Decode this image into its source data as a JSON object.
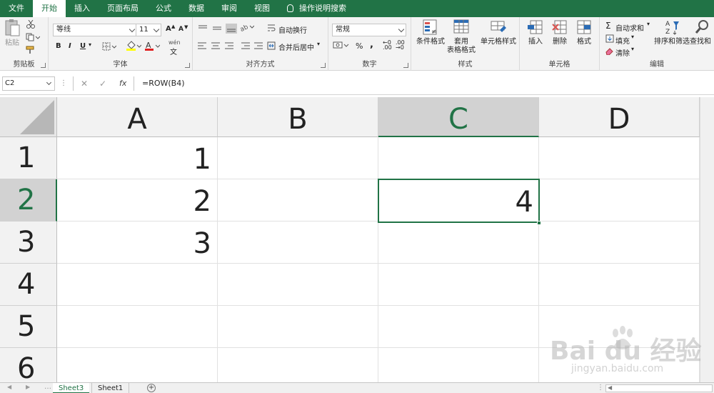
{
  "tabs": [
    {
      "label": "文件",
      "active": false
    },
    {
      "label": "开始",
      "active": true
    },
    {
      "label": "插入",
      "active": false
    },
    {
      "label": "页面布局",
      "active": false
    },
    {
      "label": "公式",
      "active": false
    },
    {
      "label": "数据",
      "active": false
    },
    {
      "label": "审阅",
      "active": false
    },
    {
      "label": "视图",
      "active": false
    }
  ],
  "tell_me": "操作说明搜索",
  "ribbon": {
    "clipboard": {
      "paste": "粘贴",
      "label": "剪贴板"
    },
    "font": {
      "name": "等线",
      "size": "11",
      "bold": "B",
      "italic": "I",
      "underline": "U",
      "grow": "A",
      "shrink": "A",
      "wen": "wén",
      "label": "字体"
    },
    "alignment": {
      "wrap": "自动换行",
      "merge": "合并后居中",
      "label": "对齐方式"
    },
    "number": {
      "format": "常规",
      "percent": "%",
      "comma": ",",
      "label": "数字"
    },
    "styles": {
      "conditional": "条件格式",
      "table_a": "套用",
      "table_b": "表格格式",
      "cell_styles": "单元格样式",
      "label": "样式"
    },
    "cells": {
      "insert": "插入",
      "delete": "删除",
      "format": "格式",
      "label": "单元格"
    },
    "editing": {
      "autosum": "自动求和",
      "fill": "填充",
      "clear": "清除",
      "sort": "排序和筛选",
      "find": "查找和",
      "label": "编辑"
    }
  },
  "formula_bar": {
    "name_box": "C2",
    "fx": "fx",
    "formula": "=ROW(B4)"
  },
  "columns": [
    "A",
    "B",
    "C",
    "D"
  ],
  "rows": [
    "1",
    "2",
    "3",
    "4",
    "5",
    "6"
  ],
  "cells": {
    "A1": "1",
    "A2": "2",
    "A3": "3",
    "C2": "4"
  },
  "sheets": [
    {
      "label": "Sheet3",
      "active": true
    },
    {
      "label": "Sheet1",
      "active": false
    }
  ],
  "watermark": {
    "main": "Bai du 经验",
    "sub": "jingyan.baidu.com"
  },
  "colors": {
    "accent": "#217346"
  }
}
